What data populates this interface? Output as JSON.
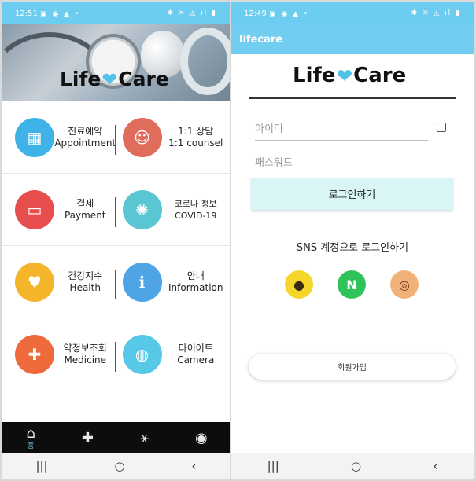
{
  "left": {
    "status": {
      "time": "12:51",
      "left_icons": "▣ ◉ ▲ •",
      "right_icons": "✱ ✕ ◬ ıl ▮"
    },
    "logo": {
      "word1": "Life",
      "word2": "Care"
    },
    "menu": [
      {
        "ko": "진료예약",
        "en": "Appointment",
        "icon": "calendar-icon",
        "color": "#3fb3e8"
      },
      {
        "ko": "1:1 상담",
        "en": "1:1 counsel",
        "icon": "doctor-icon",
        "color": "#e06d5c"
      },
      {
        "ko": "결제",
        "en": "Payment",
        "icon": "payment-icon",
        "color": "#e84e4e"
      },
      {
        "ko": "코로나 정보",
        "en": "COVID-19",
        "icon": "virus-icon",
        "color": "#5bc6d3"
      },
      {
        "ko": "건강지수",
        "en": "Health",
        "icon": "clipboard-heart-icon",
        "color": "#f5b52a"
      },
      {
        "ko": "안내",
        "en": "Information",
        "icon": "info-icon",
        "color": "#4fa4e6"
      },
      {
        "ko": "약정보조회",
        "en": "Medicine",
        "icon": "medicine-icon",
        "color": "#ef6a3b"
      },
      {
        "ko": "다이어트",
        "en": "Camera",
        "icon": "diet-icon",
        "color": "#58c8e8"
      }
    ],
    "nav": {
      "home_label": "홈",
      "home": "⌂",
      "plus": "✚",
      "share": "⚹",
      "profile": "◉"
    },
    "sys": {
      "recent": "|||",
      "home": "○",
      "back": "‹"
    }
  },
  "right": {
    "status": {
      "time": "12:49",
      "left_icons": "▣ ◉ ▲ •",
      "right_icons": "✱ ✕ ◬ ıl ▮"
    },
    "appbar_title": "lifecare",
    "logo": {
      "word1": "Life",
      "word2": "Care"
    },
    "id_placeholder": "아이디",
    "pw_placeholder": "패스워드",
    "login_label": "로그인하기",
    "sns_title": "SNS 계정으로 로그인하기",
    "sns": [
      {
        "name": "kakao",
        "glyph": "●",
        "color": "#f6d628"
      },
      {
        "name": "naver",
        "glyph": "N",
        "color": "#2fc35a"
      },
      {
        "name": "fingerprint",
        "glyph": "◎",
        "color": "#f1b27a"
      }
    ],
    "signup_label": "회원가입",
    "sys": {
      "recent": "|||",
      "home": "○",
      "back": "‹"
    }
  }
}
